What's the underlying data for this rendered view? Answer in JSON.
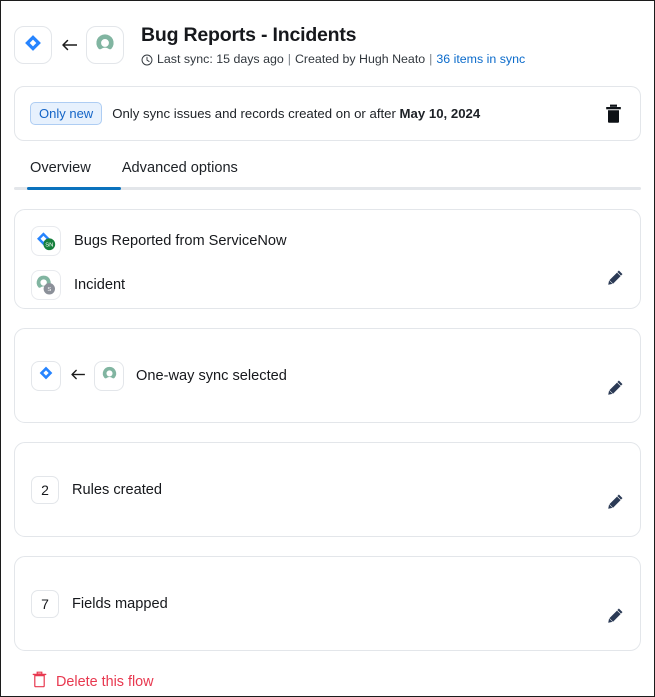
{
  "header": {
    "source_app_icon": "jira-icon",
    "direction_icon": "arrow-left-icon",
    "target_app_icon": "servicenow-icon",
    "title": "Bug Reports - Incidents",
    "meta": {
      "clock_icon": "clock-icon",
      "last_sync": "Last sync: 15 days ago",
      "separator": "|",
      "created_by": "Created by Hugh Neato",
      "items_in_sync": "36 items in sync"
    }
  },
  "banner": {
    "chip_label": "Only new",
    "text_prefix": "Only sync issues and records created on or after ",
    "date": "May 10, 2024",
    "delete_icon": "trash-icon"
  },
  "tabs": [
    {
      "label": "Overview",
      "active": true
    },
    {
      "label": "Advanced options",
      "active": false
    }
  ],
  "cards": {
    "source": {
      "rows": [
        {
          "icon": "jira-servicenow-project-icon",
          "label": "Bugs Reported from ServiceNow"
        },
        {
          "icon": "servicenow-incident-icon",
          "label": "Incident"
        }
      ],
      "edit_icon": "pencil-icon"
    },
    "sync_direction": {
      "left_icon": "jira-icon",
      "arrow_icon": "arrow-left-icon",
      "right_icon": "servicenow-icon",
      "label": "One-way sync selected",
      "edit_icon": "pencil-icon"
    },
    "rules": {
      "count": "2",
      "label": "Rules created",
      "edit_icon": "pencil-icon"
    },
    "fields": {
      "count": "7",
      "label": "Fields mapped",
      "edit_icon": "pencil-icon"
    }
  },
  "footer": {
    "delete_icon": "trash-outline-icon",
    "delete_label": "Delete this flow"
  },
  "colors": {
    "accent_blue": "#0b6bcb",
    "tab_active": "#0b72bd",
    "danger_red": "#e8384f",
    "chip_bg": "#e7f1fd",
    "chip_text": "#1565c7",
    "jira_blue": "#2684ff",
    "servicenow_green": "#81b5a1",
    "pencil_navy": "#2b3a55"
  }
}
